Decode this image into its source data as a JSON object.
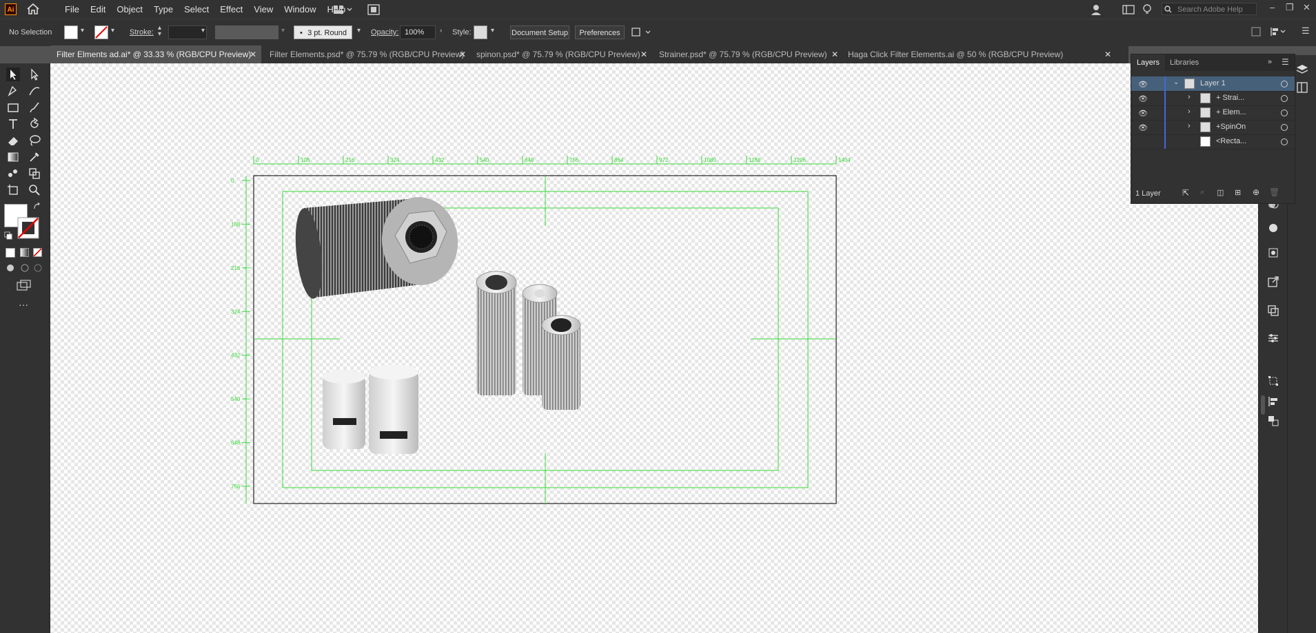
{
  "app": {
    "logo_text": "Ai"
  },
  "menu": [
    "File",
    "Edit",
    "Object",
    "Type",
    "Select",
    "Effect",
    "View",
    "Window",
    "Help"
  ],
  "search": {
    "placeholder": "Search Adobe Help"
  },
  "control": {
    "selection": "No Selection",
    "stroke_label": "Stroke:",
    "brush": "3 pt. Round",
    "opacity_label": "Opacity:",
    "opacity_value": "100%",
    "style_label": "Style:",
    "doc_setup": "Document Setup",
    "preferences": "Preferences"
  },
  "tabs": [
    {
      "label": "Filter Elments ad.ai* @ 33.33 % (RGB/CPU Preview)",
      "active": true
    },
    {
      "label": "Filter Elements.psd* @ 75.79 % (RGB/CPU Preview)",
      "active": false
    },
    {
      "label": "spinon.psd* @ 75.79 % (RGB/CPU Preview)",
      "active": false
    },
    {
      "label": "Strainer.psd* @ 75.79 % (RGB/CPU Preview)",
      "active": false
    },
    {
      "label": "Haga Click Filter Elements.ai @ 50 % (RGB/CPU Preview)",
      "active": false
    }
  ],
  "ruler": {
    "x_ticks": [
      "0",
      "108",
      "216",
      "324",
      "432",
      "540",
      "648",
      "756",
      "864",
      "972",
      "1080",
      "1188",
      "1296",
      "1404"
    ],
    "y_ticks": [
      "0",
      "108",
      "216",
      "324",
      "432",
      "540",
      "648",
      "756"
    ]
  },
  "layers_panel": {
    "tab_layers": "Layers",
    "tab_libraries": "Libraries",
    "rows": [
      {
        "name": "Layer 1",
        "selected": true
      },
      {
        "name": "+ Strai...",
        "selected": false
      },
      {
        "name": "+ Elem...",
        "selected": false
      },
      {
        "name": "+SpinOn",
        "selected": false
      },
      {
        "name": "<Recta...",
        "selected": false
      }
    ],
    "footer": "1 Layer"
  },
  "colors": {
    "accent_blue": "#46607a",
    "guide_green": "#00d000",
    "logo_orange": "#ff9a00"
  }
}
